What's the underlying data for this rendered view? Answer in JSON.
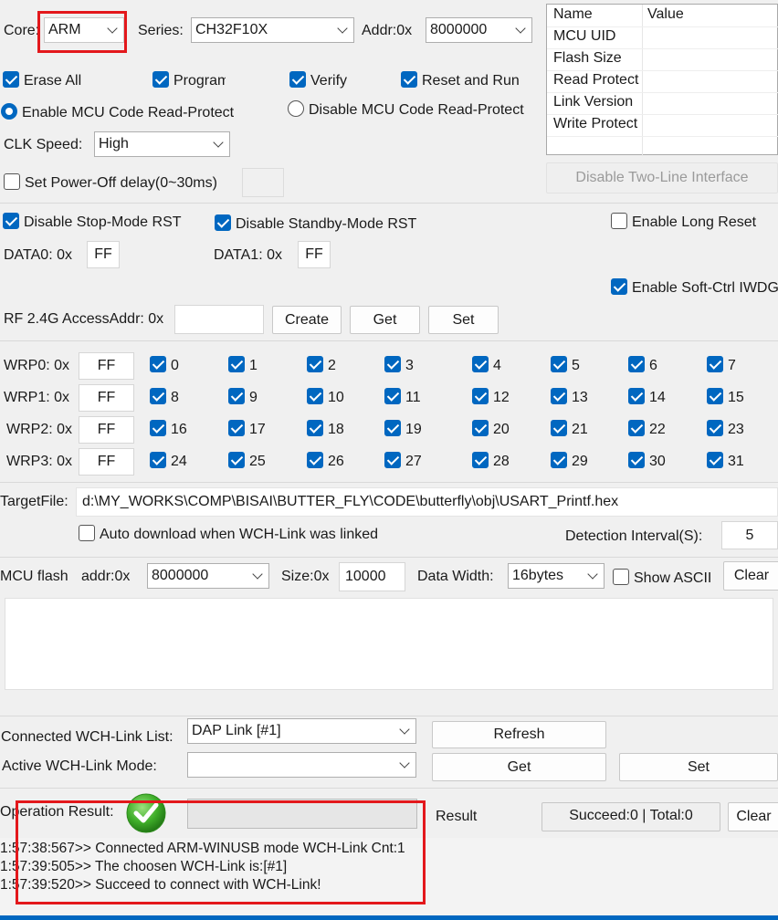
{
  "top": {
    "core_label": "Core:",
    "core_value": "ARM",
    "series_label": "Series:",
    "series_value": "CH32F10X",
    "addr_label": "Addr:0x",
    "addr_value": "8000000"
  },
  "options": {
    "erase_all": "Erase All",
    "program": "Program",
    "verify": "Verify",
    "reset_and_run": "Reset and Run",
    "enable_read_protect": "Enable MCU Code Read-Protect",
    "disable_read_protect": "Disable MCU Code Read-Protect",
    "clk_label": "CLK Speed:",
    "clk_value": "High",
    "power_off_delay": "Set Power-Off delay(0~30ms)"
  },
  "info_table": {
    "header_name": "Name",
    "header_value": "Value",
    "rows": [
      "MCU UID",
      "Flash Size",
      "Read Protect",
      "Link Version",
      "Write Protect"
    ]
  },
  "disable_two_line": "Disable Two-Line Interface",
  "option_bytes": {
    "disable_stop_rst": "Disable Stop-Mode RST",
    "disable_standby_rst": "Disable Standby-Mode RST",
    "enable_long_reset": "Enable Long Reset",
    "data0_label": "DATA0: 0x",
    "data0_value": "FF",
    "data1_label": "DATA1: 0x",
    "data1_value": "FF",
    "enable_soft_iwdg": "Enable Soft-Ctrl IWDG"
  },
  "rf": {
    "label": "RF 2.4G AccessAddr: 0x",
    "value": "",
    "create": "Create",
    "get": "Get",
    "set": "Set"
  },
  "wrp": {
    "rows": [
      {
        "label": "WRP0: 0x",
        "value": "FF",
        "bits": [
          "0",
          "1",
          "2",
          "3",
          "4",
          "5",
          "6",
          "7"
        ]
      },
      {
        "label": "WRP1: 0x",
        "value": "FF",
        "bits": [
          "8",
          "9",
          "10",
          "11",
          "12",
          "13",
          "14",
          "15"
        ]
      },
      {
        "label": "WRP2: 0x",
        "value": "FF",
        "bits": [
          "16",
          "17",
          "18",
          "19",
          "20",
          "21",
          "22",
          "23"
        ]
      },
      {
        "label": "WRP3: 0x",
        "value": "FF",
        "bits": [
          "24",
          "25",
          "26",
          "27",
          "28",
          "29",
          "30",
          "31"
        ]
      }
    ]
  },
  "target": {
    "label": "TargetFile:",
    "path": "d:\\MY_WORKS\\COMP\\BISAI\\BUTTER_FLY\\CODE\\butterfly\\obj\\USART_Printf.hex",
    "auto_download": "Auto download when WCH-Link was linked",
    "interval_label": "Detection Interval(S):",
    "interval_value": "5"
  },
  "flash": {
    "label": "MCU flash",
    "addr_label": "addr:0x",
    "addr_value": "8000000",
    "size_label": "Size:0x",
    "size_value": "10000",
    "width_label": "Data Width:",
    "width_value": "16bytes",
    "show_ascii": "Show ASCII",
    "clear": "Clear"
  },
  "link": {
    "list_label": "Connected WCH-Link List:",
    "list_value": "DAP Link [#1]",
    "refresh": "Refresh",
    "mode_label": "Active WCH-Link  Mode:",
    "mode_value": "",
    "get": "Get",
    "set": "Set"
  },
  "result": {
    "label": "Operation Result:",
    "result_label": "Result",
    "counts": "Succeed:0 | Total:0",
    "clear": "Clear"
  },
  "log": {
    "lines": [
      "1:57:38:567>> Connected ARM-WINUSB mode WCH-Link Cnt:1",
      "1:57:39:505>> The choosen WCH-Link is:[#1]",
      "1:57:39:520>> Succeed to connect with WCH-Link!"
    ]
  },
  "colors": {
    "accent": "#0067c0",
    "highlight": "#e3181c",
    "success": "#3fae29"
  }
}
